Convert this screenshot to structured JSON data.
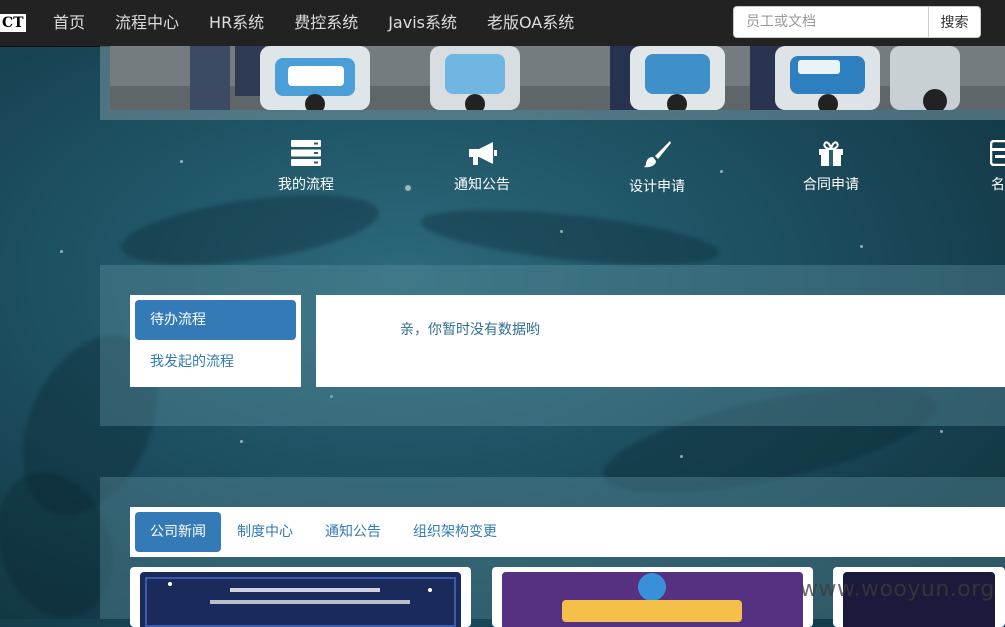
{
  "brand": {
    "text": "CT"
  },
  "nav": {
    "items": [
      {
        "label": "首页"
      },
      {
        "label": "流程中心"
      },
      {
        "label": "HR系统"
      },
      {
        "label": "费控系统"
      },
      {
        "label": "Javis系统"
      },
      {
        "label": "老版OA系统"
      }
    ]
  },
  "search": {
    "placeholder": "员工或文档",
    "button_label": "搜索"
  },
  "quick_links": [
    {
      "label": "我的流程",
      "icon": "server-icon"
    },
    {
      "label": "通知公告",
      "icon": "bullhorn-icon"
    },
    {
      "label": "设计申请",
      "icon": "paintbrush-icon"
    },
    {
      "label": "合同申请",
      "icon": "gift-icon"
    },
    {
      "label": "名片",
      "icon": "card-icon"
    }
  ],
  "process_panel": {
    "menu": [
      {
        "label": "待办流程",
        "active": true
      },
      {
        "label": "我发起的流程",
        "active": false
      }
    ],
    "empty_message": "亲，你暂时没有数据哟"
  },
  "news_panel": {
    "tabs": [
      {
        "label": "公司新闻",
        "active": true
      },
      {
        "label": "制度中心",
        "active": false
      },
      {
        "label": "通知公告",
        "active": false
      },
      {
        "label": "组织架构变更",
        "active": false
      }
    ]
  },
  "watermark": "www.wooyun.org",
  "colors": {
    "navbar_bg": "#222222",
    "accent": "#337ab7",
    "empty_text": "#31708f",
    "nav_text": "#dddddd"
  }
}
